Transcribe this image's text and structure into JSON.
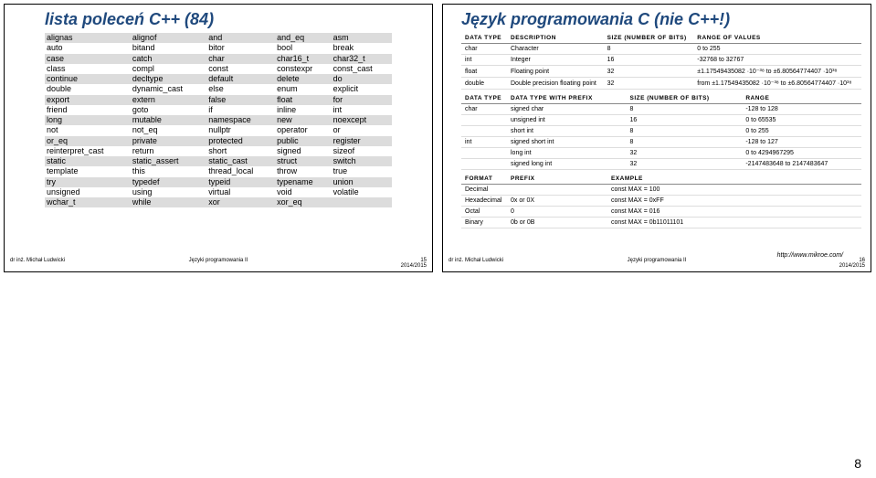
{
  "left": {
    "title": "lista poleceń C++ (84)",
    "keywords": [
      [
        "alignas",
        "alignof",
        "and",
        "and_eq",
        "asm"
      ],
      [
        "auto",
        "bitand",
        "bitor",
        "bool",
        "break"
      ],
      [
        "case",
        "catch",
        "char",
        "char16_t",
        "char32_t"
      ],
      [
        "class",
        "compl",
        "const",
        "constexpr",
        "const_cast"
      ],
      [
        "continue",
        "decltype",
        "default",
        "delete",
        "do"
      ],
      [
        "double",
        "dynamic_cast",
        "else",
        "enum",
        "explicit"
      ],
      [
        "export",
        "extern",
        "false",
        "float",
        "for"
      ],
      [
        "friend",
        "goto",
        "if",
        "inline",
        "int"
      ],
      [
        "long",
        "mutable",
        "namespace",
        "new",
        "noexcept"
      ],
      [
        "not",
        "not_eq",
        "nullptr",
        "operator",
        "or"
      ],
      [
        "or_eq",
        "private",
        "protected",
        "public",
        "register"
      ],
      [
        "reinterpret_cast",
        "return",
        "short",
        "signed",
        "sizeof"
      ],
      [
        "static",
        "static_assert",
        "static_cast",
        "struct",
        "switch"
      ],
      [
        "template",
        "this",
        "thread_local",
        "throw",
        "true"
      ],
      [
        "try",
        "typedef",
        "typeid",
        "typename",
        "union"
      ],
      [
        "unsigned",
        "using",
        "virtual",
        "void",
        "volatile"
      ],
      [
        "wchar_t",
        "while",
        "xor",
        "xor_eq",
        ""
      ]
    ],
    "footer": {
      "author": "dr inż. Michał Ludwicki",
      "course": "Języki programowania II",
      "year": "2014/2015",
      "page": "15"
    }
  },
  "right": {
    "title": "Język programowania C (nie C++!)",
    "table1": {
      "headers": [
        "DATA TYPE",
        "DESCRIPTION",
        "SIZE (NUMBER OF BITS)",
        "RANGE OF VALUES"
      ],
      "rows": [
        [
          "char",
          "Character",
          "8",
          "0 to 255"
        ],
        [
          "int",
          "Integer",
          "16",
          "-32768 to 32767"
        ],
        [
          "float",
          "Floating point",
          "32",
          "±1.17549435082 ·10⁻³⁸ to ±6.80564774407 ·10³⁸"
        ],
        [
          "double",
          "Double precision floating point",
          "32",
          "from ±1.17549435082 ·10⁻³⁸ to ±6.80564774407 ·10³⁸"
        ]
      ]
    },
    "table2": {
      "headers": [
        "DATA TYPE",
        "DATA TYPE WITH PREFIX",
        "SIZE (NUMBER OF BITS)",
        "RANGE"
      ],
      "rows": [
        [
          "char",
          "signed char",
          "8",
          "-128 to 128"
        ],
        [
          "",
          "unsigned int",
          "16",
          "0 to 65535"
        ],
        [
          "",
          "short int",
          "8",
          "0 to 255"
        ],
        [
          "int",
          "signed short int",
          "8",
          "-128 to 127"
        ],
        [
          "",
          "long int",
          "32",
          "0 to 4294967295"
        ],
        [
          "",
          "signed long int",
          "32",
          "-2147483648 to 2147483647"
        ]
      ]
    },
    "table3": {
      "headers": [
        "FORMAT",
        "PREFIX",
        "EXAMPLE"
      ],
      "rows": [
        [
          "Decimal",
          "",
          "const MAX = 100"
        ],
        [
          "Hexadecimal",
          "0x or 0X",
          "const MAX = 0xFF"
        ],
        [
          "Octal",
          "0",
          "const MAX = 016"
        ],
        [
          "Binary",
          "0b or 0B",
          "const MAX = 0b11011101"
        ]
      ]
    },
    "source": "http://www.mikroe.com/",
    "footer": {
      "author": "dr inż. Michał Ludwicki",
      "course": "Języki programowania II",
      "year": "2014/2015",
      "page": "16"
    }
  },
  "bigPage": "8"
}
